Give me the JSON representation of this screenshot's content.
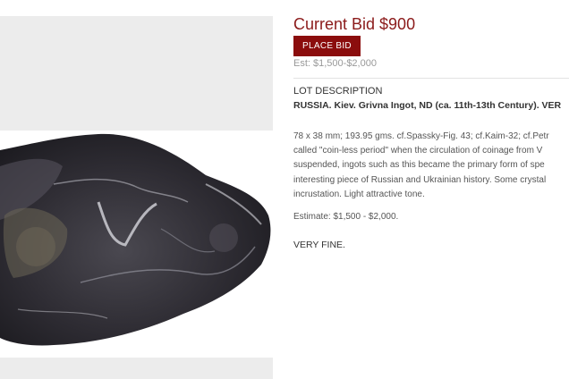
{
  "bid": {
    "title": "Current Bid $900",
    "button_label": "PLACE BID",
    "estimate": "Est: $1,500-$2,000"
  },
  "lot": {
    "heading": "LOT DESCRIPTION",
    "title": "RUSSIA. Kiev. Grivna Ingot, ND (ca. 11th-13th Century). VER",
    "description_lines": [
      "78 x 38 mm; 193.95 gms. cf.Spassky-Fig. 43; cf.Kaim-32; cf.Petr",
      "called \"coin-less period\" when the circulation of coinage from V",
      "suspended, ingots such as this became the primary form of spe",
      "interesting piece of Russian and Ukrainian history. Some crystal",
      "incrustation. Light attractive tone."
    ],
    "estimate": "Estimate: $1,500 - $2,000.",
    "grade": "VERY FINE."
  },
  "image": {
    "subject": "silver-grivna-ingot",
    "colors": {
      "panel_bg": "#ececec",
      "metal_dark": "#2b2a30",
      "metal_light": "#c9c9cf"
    }
  },
  "colors": {
    "accent": "#8b0d0d",
    "title": "#8b1a1a"
  }
}
